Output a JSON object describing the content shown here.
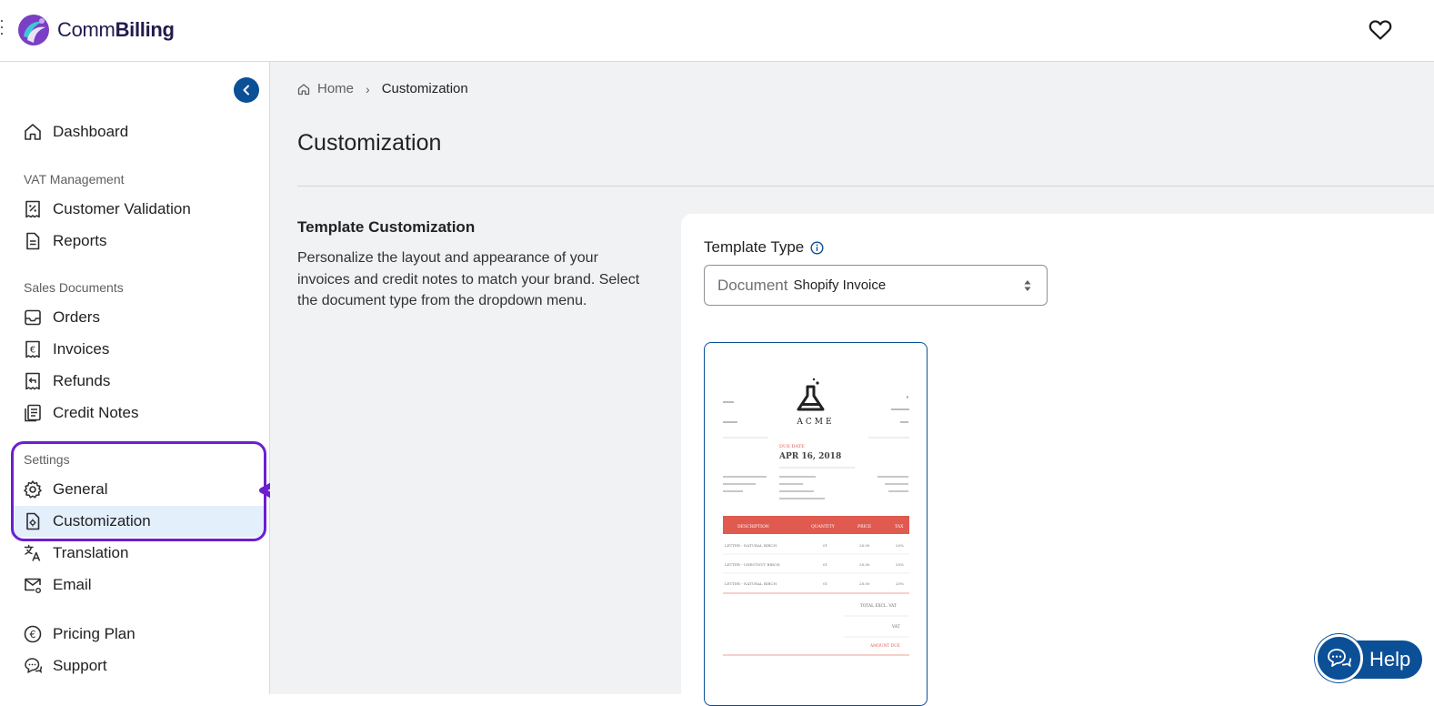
{
  "app": {
    "logo_prefix": "Comm",
    "logo_suffix": "Billing"
  },
  "sidebar": {
    "dashboard": "Dashboard",
    "vat_section": "VAT Management",
    "customer_validation": "Customer Validation",
    "reports": "Reports",
    "sales_section": "Sales Documents",
    "orders": "Orders",
    "invoices": "Invoices",
    "refunds": "Refunds",
    "credit_notes": "Credit Notes",
    "settings_section": "Settings",
    "general": "General",
    "customization": "Customization",
    "translation": "Translation",
    "email": "Email",
    "pricing_plan": "Pricing Plan",
    "support": "Support",
    "active_item": "customization"
  },
  "breadcrumb": {
    "home": "Home",
    "current": "Customization"
  },
  "page": {
    "title": "Customization",
    "section_title": "Template Customization",
    "section_description": "Personalize the layout and appearance of your invoices and credit notes to match your brand. Select the document type from the dropdown menu."
  },
  "template": {
    "label": "Template Type",
    "select_prefix": "Document",
    "select_value": "Shopify Invoice"
  },
  "preview": {
    "brand": "ACME",
    "date_label": "DUE DATE",
    "date": "APR 16, 2018",
    "columns": [
      "DESCRIPTION",
      "QUANTITY",
      "PRICE",
      "TAX"
    ],
    "rows": [
      [
        "LETTER - NATURAL BIRCH",
        "01",
        "28.00",
        "20%"
      ],
      [
        "LETTER - CHESTNUT BIRCH",
        "01",
        "28.00",
        "20%"
      ],
      [
        "LETTER - NATURAL BIRCH",
        "01",
        "28.00",
        "20%"
      ]
    ],
    "total_label": "TOTAL EXCL. VAT",
    "vat_label": "VAT",
    "amount_label": "AMOUNT DUE"
  },
  "help": {
    "label": "Help"
  },
  "colors": {
    "brand_blue": "#0b4f96",
    "annotation_purple": "#6b1fd1",
    "invoice_red": "#e05a4f"
  }
}
